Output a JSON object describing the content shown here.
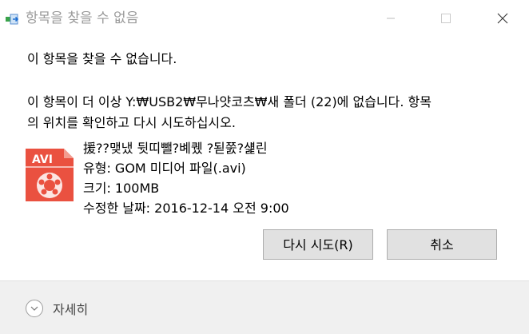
{
  "window": {
    "title": "항목을 찾을 수 없음"
  },
  "message": {
    "heading": "이 항목을 찾을 수 없습니다.",
    "detail_line1": "이 항목이 더 이상 Y:₩USB2₩무나얏코츠₩새 폴더 (22)에 없습니다. 항목",
    "detail_line2": "의 위치를 확인하고 다시 시도하십시오."
  },
  "file": {
    "name": "援??맺냈 뒷띠뺄?볘퀬 ?됟쭔?섍린",
    "type": "유형: GOM 미디어 파일(.avi)",
    "size": "크기: 100MB",
    "modified": "수정한 날짜: 2016-12-14 오전 9:00",
    "icon_label": "AVI",
    "icon": "avi-file-icon"
  },
  "buttons": {
    "retry": "다시 시도(R)",
    "cancel": "취소"
  },
  "footer": {
    "details_label": "자세히"
  },
  "colors": {
    "icon_red": "#e84c3d",
    "button_bg": "#e1e1e1",
    "footer_bg": "#f0f0f0"
  }
}
